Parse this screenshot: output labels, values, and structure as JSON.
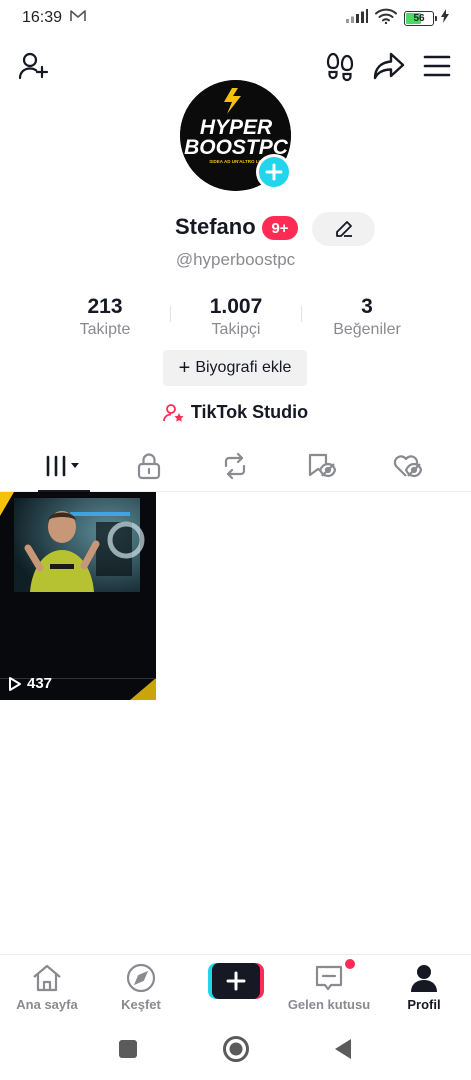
{
  "status_bar": {
    "time": "16:39",
    "battery_level": "56"
  },
  "profile": {
    "avatar_text_line1": "HYPER",
    "avatar_text_line2": "BOOSTPC",
    "avatar_tagline": "SIDEA AD UN'ALTRO LIVELLO",
    "name": "Stefano",
    "notification_badge": "9+",
    "handle": "@hyperboostpc",
    "stats": [
      {
        "value": "213",
        "label": "Takipte"
      },
      {
        "value": "1.007",
        "label": "Takipçi"
      },
      {
        "value": "3",
        "label": "Beğeniler"
      }
    ],
    "bio_button": "Biyografi ekle",
    "studio_label": "TikTok Studio"
  },
  "tabs": [
    {
      "icon": "grid-icon",
      "active": true
    },
    {
      "icon": "lock-icon",
      "active": false
    },
    {
      "icon": "repost-icon",
      "active": false
    },
    {
      "icon": "bookmark-icon",
      "active": false
    },
    {
      "icon": "liked-icon",
      "active": false
    }
  ],
  "videos": [
    {
      "views": "437"
    }
  ],
  "bottom_nav": [
    {
      "label": "Ana sayfa",
      "icon": "home-icon"
    },
    {
      "label": "Keşfet",
      "icon": "compass-icon"
    },
    {
      "label": "",
      "icon": "plus-icon"
    },
    {
      "label": "Gelen kutusu",
      "icon": "inbox-icon"
    },
    {
      "label": "Profil",
      "icon": "profile-icon"
    }
  ],
  "colors": {
    "accent": "#fe2c55",
    "cyan": "#20d5ec",
    "text": "#161823",
    "muted": "#8a8b91"
  }
}
